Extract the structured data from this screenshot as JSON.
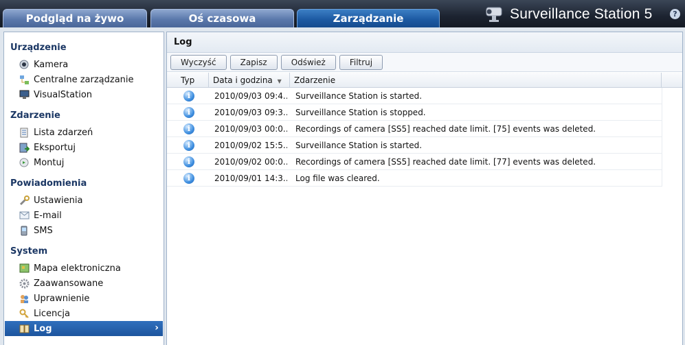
{
  "tabs": [
    {
      "label": "Podgląd na żywo",
      "active": false
    },
    {
      "label": "Oś czasowa",
      "active": false
    },
    {
      "label": "Zarządzanie",
      "active": true
    }
  ],
  "brand": {
    "title": "Surveillance Station 5",
    "help": "?"
  },
  "sidebar": {
    "sections": [
      {
        "title": "Urządzenie",
        "items": [
          {
            "label": "Kamera",
            "icon": "camera-icon"
          },
          {
            "label": "Centralne zarządzanie",
            "icon": "network-icon"
          },
          {
            "label": "VisualStation",
            "icon": "monitor-icon"
          }
        ]
      },
      {
        "title": "Zdarzenie",
        "items": [
          {
            "label": "Lista zdarzeń",
            "icon": "list-icon"
          },
          {
            "label": "Eksportuj",
            "icon": "export-icon"
          },
          {
            "label": "Montuj",
            "icon": "mount-icon"
          }
        ]
      },
      {
        "title": "Powiadomienia",
        "items": [
          {
            "label": "Ustawienia",
            "icon": "wrench-icon"
          },
          {
            "label": "E-mail",
            "icon": "mail-icon"
          },
          {
            "label": "SMS",
            "icon": "phone-icon"
          }
        ]
      },
      {
        "title": "System",
        "items": [
          {
            "label": "Mapa elektroniczna",
            "icon": "map-icon"
          },
          {
            "label": "Zaawansowane",
            "icon": "gear-icon"
          },
          {
            "label": "Uprawnienie",
            "icon": "users-icon"
          },
          {
            "label": "Licencja",
            "icon": "key-icon"
          },
          {
            "label": "Log",
            "icon": "book-icon",
            "selected": true
          }
        ]
      }
    ]
  },
  "main": {
    "title": "Log",
    "toolbar": {
      "clear": "Wyczyść",
      "save": "Zapisz",
      "refresh": "Odśwież",
      "filter": "Filtruj"
    },
    "columns": {
      "type": "Typ",
      "datetime": "Data i godzina",
      "event": "Zdarzenie"
    },
    "rows": [
      {
        "datetime": "2010/09/03 09:4...",
        "event": "Surveillance Station is started."
      },
      {
        "datetime": "2010/09/03 09:3...",
        "event": "Surveillance Station is stopped."
      },
      {
        "datetime": "2010/09/03 00:0...",
        "event": "Recordings of camera [SS5] reached date limit. [75] events was deleted."
      },
      {
        "datetime": "2010/09/02 15:5...",
        "event": "Surveillance Station is started."
      },
      {
        "datetime": "2010/09/02 00:0...",
        "event": "Recordings of camera [SS5] reached date limit. [77] events was deleted."
      },
      {
        "datetime": "2010/09/01 14:3...",
        "event": "Log file was cleared."
      }
    ]
  }
}
